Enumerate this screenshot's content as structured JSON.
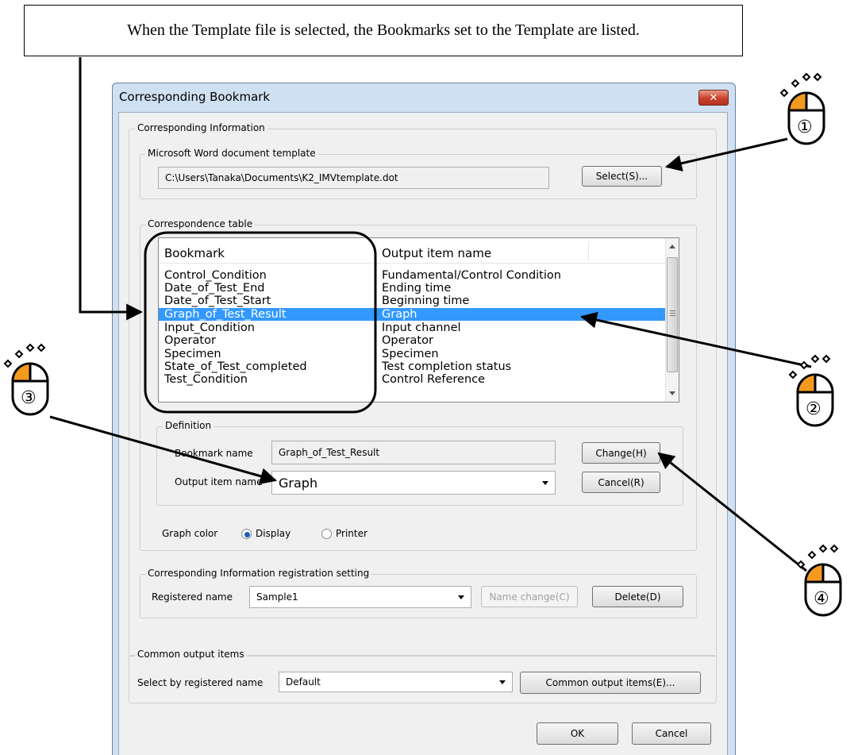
{
  "callout": "When the Template file is selected, the Bookmarks set to the Template are listed.",
  "dialog": {
    "title": "Corresponding Bookmark",
    "close_glyph": "✕",
    "corresponding_information": {
      "legend": "Corresponding Information",
      "template": {
        "legend": "Microsoft Word document template",
        "path": "C:\\Users\\Tanaka\\Documents\\K2_IMVtemplate.dot",
        "select_button": "Select(S)..."
      },
      "table": {
        "legend": "Correspondence table",
        "headers": [
          "Bookmark",
          "Output item name"
        ],
        "rows": [
          {
            "bookmark": "Control_Condition",
            "output": "Fundamental/Control Condition"
          },
          {
            "bookmark": "Date_of_Test_End",
            "output": "Ending time"
          },
          {
            "bookmark": "Date_of_Test_Start",
            "output": "Beginning time"
          },
          {
            "bookmark": "Graph_of_Test_Result",
            "output": "Graph"
          },
          {
            "bookmark": "Input_Condition",
            "output": "Input channel"
          },
          {
            "bookmark": "Operator",
            "output": "Operator"
          },
          {
            "bookmark": "Specimen",
            "output": "Specimen"
          },
          {
            "bookmark": "State_of_Test_completed",
            "output": "Test completion status"
          },
          {
            "bookmark": "Test_Condition",
            "output": "Control Reference"
          }
        ],
        "selected_index": 3
      },
      "definition": {
        "legend": "Definition",
        "bookmark_name_label": "Bookmark name",
        "bookmark_name_value": "Graph_of_Test_Result",
        "output_item_label": "Output item name",
        "output_item_value": "Graph",
        "change_button": "Change(H)",
        "cancel_button": "Cancel(R)"
      },
      "graph_color": {
        "label": "Graph color",
        "options": [
          "Display",
          "Printer"
        ],
        "selected": "Display"
      },
      "registration": {
        "legend": "Corresponding Information registration setting",
        "registered_name_label": "Registered name",
        "registered_name_value": "Sample1",
        "name_change_button": "Name change(C)",
        "delete_button": "Delete(D)"
      }
    },
    "common_output": {
      "legend": "Common output items",
      "select_label": "Select by registered name",
      "select_value": "Default",
      "button": "Common output items(E)..."
    },
    "ok_button": "OK",
    "cancel_button": "Cancel"
  },
  "annotations": {
    "step1": "①",
    "step2": "②",
    "step3": "③",
    "step4": "④"
  },
  "colors": {
    "mouse_button": "#f39a1e",
    "selection": "#3399ff",
    "title_bar": "#cfe0f2",
    "close_button": "#c8412b"
  }
}
